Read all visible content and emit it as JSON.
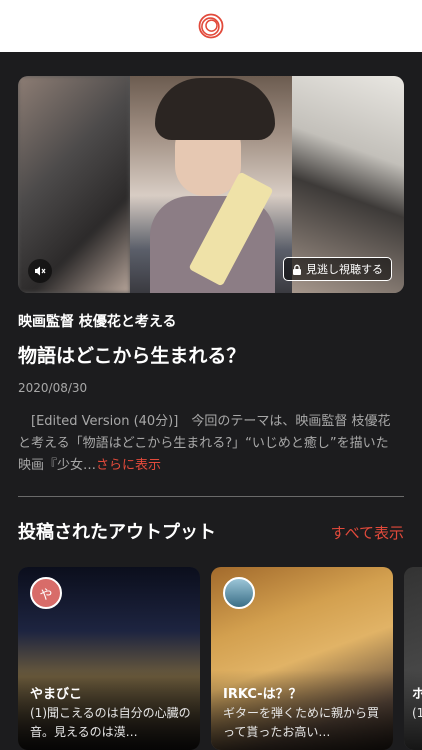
{
  "header": {
    "logo": "spiral-logo-icon",
    "accent": "#e24a3b"
  },
  "video": {
    "mute_icon": "speaker-muted-icon",
    "lock_icon": "lock-icon",
    "watch_label": "見逃し視聴する"
  },
  "episode": {
    "subtitle": "映画監督 枝優花と考える",
    "title": "物語はどこから生まれる？",
    "date": "2020/08/30",
    "description": "[Edited Version (40分)]　今回のテーマは、映画監督 枝優花と考える「物語はどこから生まれる?」“いじめと癒し”を描いた映画『少女…",
    "more_label": "さらに表示"
  },
  "outputs": {
    "section_title": "投稿されたアウトプット",
    "show_all": "すべて表示",
    "cards": [
      {
        "avatar_text": "や",
        "author": "やまびこ",
        "text": "(1)聞こえるのは自分の心臓の音。見えるのは漠…"
      },
      {
        "avatar_text": "",
        "author": "IRKC-は？？",
        "text": "ギターを弾くために親から買って貰ったお高い…"
      },
      {
        "avatar_text": "",
        "author": "ホ",
        "text": "(1"
      }
    ]
  }
}
